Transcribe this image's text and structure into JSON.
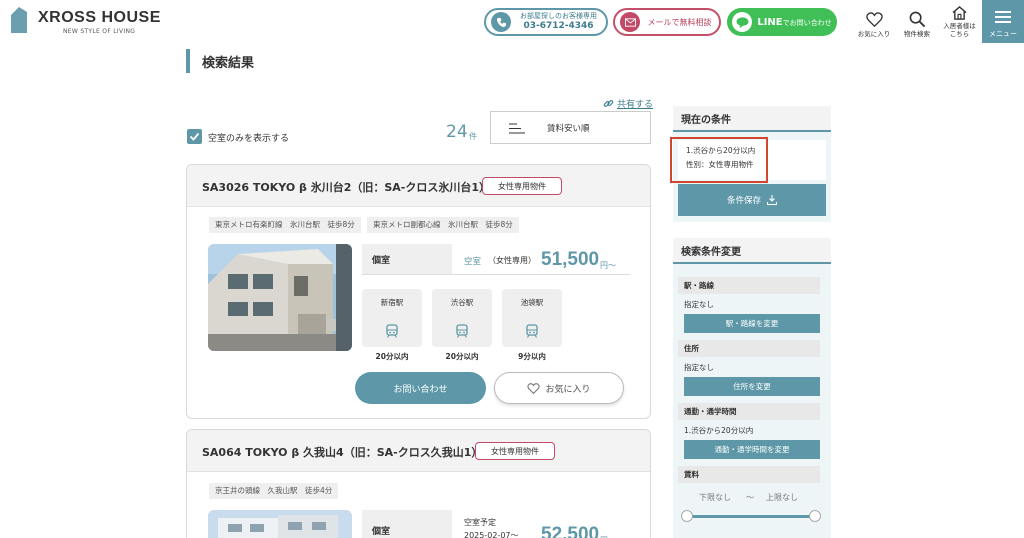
{
  "brand": {
    "name": "XROSS HOUSE",
    "tagline": "NEW STYLE OF LIVING"
  },
  "header": {
    "phone": {
      "line1": "お部屋探しのお客様専用",
      "line2": "03-6712-4346"
    },
    "mail_label": "メールで無料相談",
    "line": {
      "big": "LINE",
      "small": "でお問い合わせ"
    },
    "favorites_label": "お気に入り",
    "search_label": "物件検索",
    "residents_label_1": "入居者様は",
    "residents_label_2": "こちら",
    "menu_label": "メニュー"
  },
  "page": {
    "title": "検索結果",
    "share_label": "共有する"
  },
  "controls": {
    "vacant_only_label": "空室のみを表示する",
    "count": "24",
    "count_suffix": "件",
    "sort_label": "賃料安い順"
  },
  "listings": [
    {
      "name": "SA3026 TOKYO β 氷川台2（旧：SA-クロス氷川台1）",
      "badge": "女性専用物件",
      "access": [
        "東京メトロ有楽町線　氷川台駅　徒歩8分",
        "東京メトロ副都心線　氷川台駅　徒歩8分"
      ],
      "room_type": "個室",
      "status": "空室",
      "status_note": "（女性専用）",
      "price": "51,500",
      "price_unit": "円〜",
      "stations": [
        {
          "name": "新宿駅",
          "time": "20分以内"
        },
        {
          "name": "渋谷駅",
          "time": "20分以内"
        },
        {
          "name": "池袋駅",
          "time": "9分以内"
        }
      ],
      "inquiry_label": "お問い合わせ",
      "favorite_label": "お気に入り"
    },
    {
      "name": "SA064 TOKYO β 久我山4（旧：SA-クロス久我山1）",
      "badge": "女性専用物件",
      "access": [
        "京王井の頭線　久我山駅　徒歩4分"
      ],
      "room_type": "個室",
      "status_line1": "空室予定",
      "status_line2": "2025-02-07〜",
      "price": "52,500",
      "price_unit": "円〜"
    }
  ],
  "sidebar": {
    "current_title": "現在の条件",
    "conditions": [
      "1.渋谷から20分以内",
      "性別：女性専用物件"
    ],
    "save_label": "条件保存",
    "change_title": "検索条件変更",
    "sections": [
      {
        "title": "駅・路線",
        "value": "指定なし",
        "button": "駅・路線を変更"
      },
      {
        "title": "住所",
        "value": "指定なし",
        "button": "住所を変更"
      },
      {
        "title": "通勤・通学時間",
        "value": "1.渋谷から20分以内",
        "button": "通勤・通学時間を変更"
      }
    ],
    "rent": {
      "title": "賃料",
      "min": "下限なし",
      "sep": "〜",
      "max": "上限なし"
    }
  },
  "colors": {
    "accent": "#5e98a8",
    "pink": "#c24a66",
    "line_green": "#3fbf55",
    "highlight_red": "#d2452e"
  }
}
